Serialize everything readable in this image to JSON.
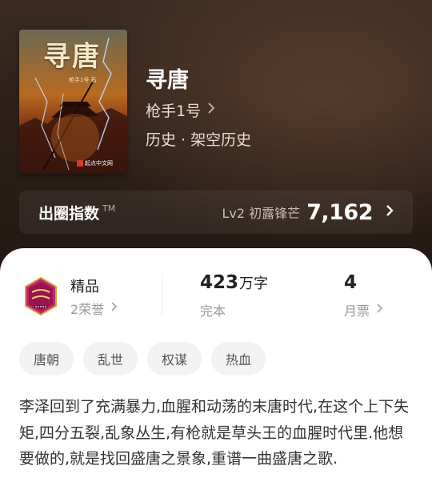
{
  "book": {
    "title": "寻唐",
    "author": "枪手1号",
    "genre": "历史 · 架空历史",
    "cover": {
      "title": "寻唐",
      "author": "枪手1号 著",
      "publisher": "起点中文网"
    }
  },
  "index": {
    "label": "出圈指数",
    "tm": "TM",
    "level": "Lv2 初露锋芒",
    "value": "7,162"
  },
  "stats": {
    "quality": {
      "label": "精品",
      "sub": "2荣誉"
    },
    "words": {
      "value": "423",
      "unit": "万字",
      "sub": "完本"
    },
    "tickets": {
      "value": "4",
      "sub": "月票"
    }
  },
  "tags": [
    "唐朝",
    "乱世",
    "权谋",
    "热血"
  ],
  "description": "李泽回到了充满暴力,血腥和动荡的末唐时代,在这个上下失矩,四分五裂,乱象丛生,有枪就是草头王的血腥时代里.他想要做的,就是找回盛唐之景象,重谱一曲盛唐之歌.",
  "icons": {
    "author_chevron": "chevron-right-icon",
    "index_chevron": "chevron-right-icon",
    "badge": "quality-badge-icon"
  },
  "colors": {
    "hero_bg": "#2d2019",
    "panel_bg": "#ffffff",
    "badge_primary": "#c0246a",
    "badge_ring": "#d4a53a"
  }
}
